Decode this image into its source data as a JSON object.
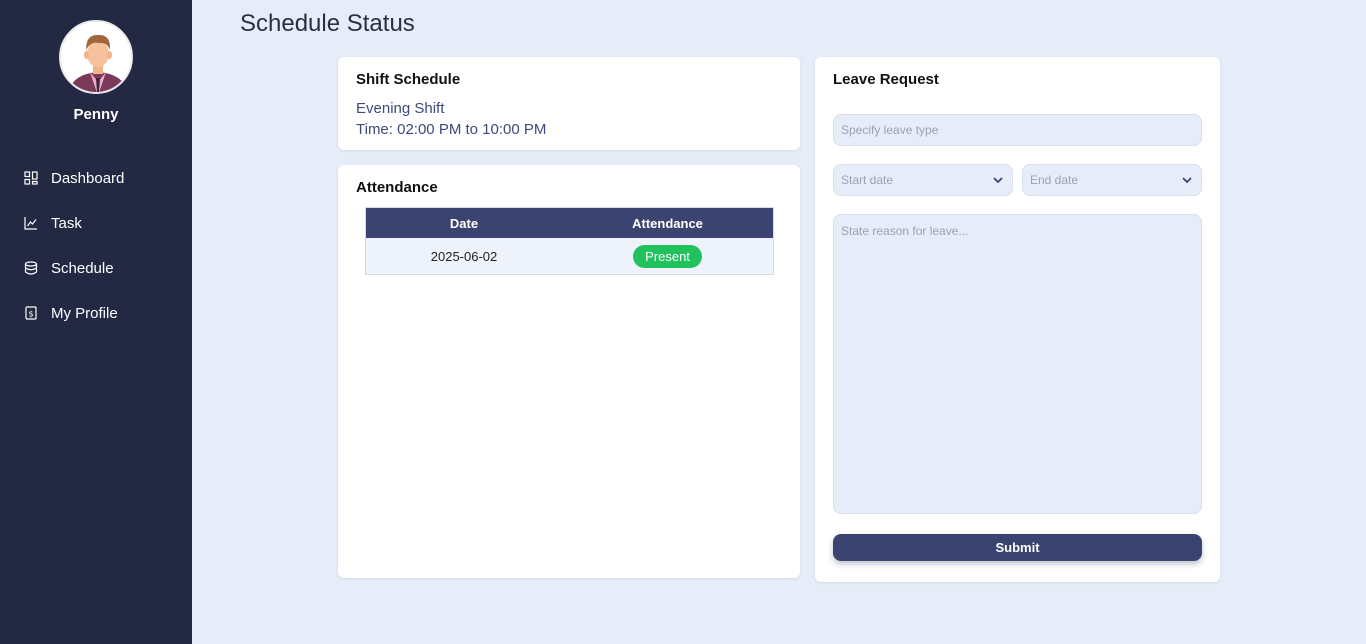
{
  "user": {
    "name": "Penny"
  },
  "nav": [
    {
      "label": "Dashboard",
      "icon": "dashboard-icon"
    },
    {
      "label": "Task",
      "icon": "chart-line-icon"
    },
    {
      "label": "Schedule",
      "icon": "database-icon"
    },
    {
      "label": "My Profile",
      "icon": "dollar-document-icon"
    }
  ],
  "page": {
    "title": "Schedule Status"
  },
  "shift": {
    "title": "Shift Schedule",
    "name": "Evening Shift",
    "time": "Time: 02:00 PM to 10:00 PM"
  },
  "attendance": {
    "title": "Attendance",
    "headers": [
      "Date",
      "Attendance"
    ],
    "rows": [
      {
        "date": "2025-06-02",
        "status": "Present"
      }
    ]
  },
  "leave": {
    "title": "Leave Request",
    "type_placeholder": "Specify leave type",
    "start_placeholder": "Start date",
    "end_placeholder": "End date",
    "reason_placeholder": "State reason for leave...",
    "submit_label": "Submit"
  },
  "colors": {
    "sidebar": "#232843",
    "accent": "#3b4470",
    "present": "#21c25e",
    "background": "#e6edf8"
  }
}
